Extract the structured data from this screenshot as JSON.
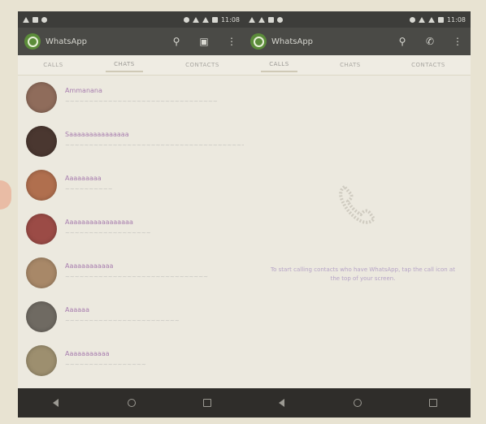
{
  "colors": {
    "app_bar": "#4a4a46",
    "status_bar": "#3d3d3a",
    "nav_bar": "#2f2d2a",
    "logo_green": "#5b8c3a",
    "name_text": "#a77dae",
    "empty_text": "#b5a3c6"
  },
  "left_phone": {
    "status": {
      "time": "11:08"
    },
    "app_title": "WhatsApp",
    "actions": [
      {
        "icon": "search-icon"
      },
      {
        "icon": "new-chat-icon"
      },
      {
        "icon": "overflow-menu-icon"
      }
    ],
    "tabs": [
      {
        "label": "CALLS"
      },
      {
        "label": "CHATS",
        "active": true
      },
      {
        "label": "CONTACTS"
      }
    ],
    "chats": [
      {
        "name": "Ammanana",
        "message": "~~~~~~~~~~~~~~~~~~~~~~~~~~~~~~~~",
        "time": "",
        "avatar_color": "#8f6c5b"
      },
      {
        "name": "Saaaaaaaaaaaaaaa",
        "message": "~~~~~~~~~~~~~~~~~~~~~~~~~~~~~~~~~~~~~~~~~~~~~~",
        "time": "",
        "avatar_color": "#4a3730"
      },
      {
        "name": "Aaaaaaaaa",
        "message": "~~~~~~~~~~",
        "time": "",
        "avatar_color": "#b06f4e"
      },
      {
        "name": "Aaaaaaaaaaaaaaaaa",
        "message": "~~~~~~~~~~~~~~~~~~",
        "time": "",
        "avatar_color": "#9b4b46"
      },
      {
        "name": "Aaaaaaaaaaaa",
        "message": "~~~~~~~~~~~~~~~~~~~~~~~~~~~~~~",
        "time": "",
        "avatar_color": "#a88868"
      },
      {
        "name": "Aaaaaa",
        "message": "~~~~~~~~~~~~~~~~~~~~~~~~",
        "time": "",
        "avatar_color": "#6f6a62"
      },
      {
        "name": "Aaaaaaaaaaa",
        "message": "~~~~~~~~~~~~~~~~~",
        "time": "",
        "avatar_color": "#9d8f6f"
      }
    ]
  },
  "right_phone": {
    "status": {
      "time": "11:08"
    },
    "app_title": "WhatsApp",
    "actions": [
      {
        "icon": "search-icon"
      },
      {
        "icon": "add-call-icon"
      },
      {
        "icon": "overflow-menu-icon"
      }
    ],
    "tabs": [
      {
        "label": "CALLS",
        "active": true
      },
      {
        "label": "CHATS"
      },
      {
        "label": "CONTACTS"
      }
    ],
    "empty_state": {
      "icon": "phone-handset-icon",
      "text": "To start calling contacts who have WhatsApp, tap the call icon at the top of your screen."
    }
  },
  "nav": {
    "back": "nav-back-icon",
    "home": "nav-home-icon",
    "recent": "nav-recent-apps-icon"
  }
}
